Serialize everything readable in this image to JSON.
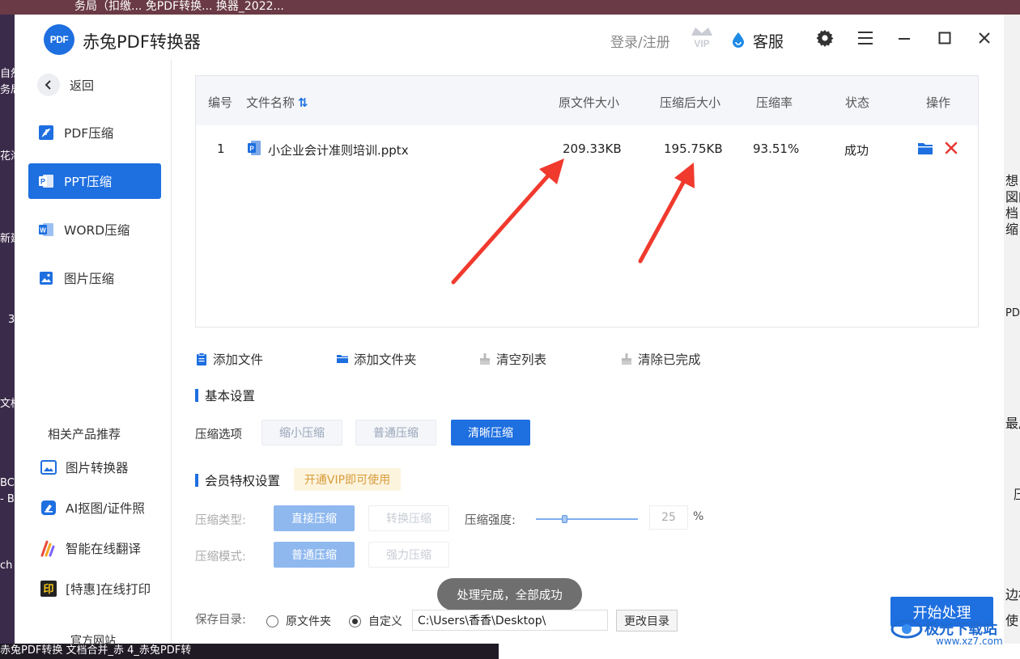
{
  "desktop": {
    "top_text": "务局（扣缴... 免PDF转换... 换器_2022...",
    "left_fragments": [
      "自然",
      "务局",
      "花海",
      "新建",
      "3",
      "文档",
      "BC",
      "- B",
      "ch"
    ],
    "right_fragments": [
      "想",
      "図的",
      "档",
      "缩",
      "PD",
      "最后",
      "压",
      "边框",
      "使"
    ],
    "taskbar_text": "赤兔PDF转换  文档合并_赤  4_赤兔PDF转",
    "watermark_text": "极光下载站",
    "watermark_url": "www.xz7.com"
  },
  "titlebar": {
    "logo_text": "PDF",
    "title": "赤兔PDF转换器",
    "login": "登录/注册",
    "vip_badge": "VIP",
    "service": "客服"
  },
  "sidebar": {
    "back": "返回",
    "nav": [
      {
        "label": "PDF压缩",
        "icon": "pdf-icon"
      },
      {
        "label": "PPT压缩",
        "icon": "ppt-icon",
        "active": true
      },
      {
        "label": "WORD压缩",
        "icon": "word-icon"
      },
      {
        "label": "图片压缩",
        "icon": "image-icon"
      }
    ],
    "recommend_title": "相关产品推荐",
    "recommend": [
      {
        "label": "图片转换器",
        "icon": "image-convert-icon"
      },
      {
        "label": "AI抠图/证件照",
        "icon": "eraser-icon"
      },
      {
        "label": "智能在线翻译",
        "icon": "translate-icon"
      },
      {
        "label": "[特惠]在线打印",
        "icon": "print-icon"
      }
    ],
    "official_site": "官方网站"
  },
  "table": {
    "headers": {
      "index": "编号",
      "name": "文件名称",
      "orig_size": "原文件大小",
      "new_size": "压缩后大小",
      "ratio": "压缩率",
      "status": "状态",
      "action": "操作"
    },
    "rows": [
      {
        "index": "1",
        "name": "小企业会计准则培训.pptx",
        "orig_size": "209.33KB",
        "new_size": "195.75KB",
        "ratio": "93.51%",
        "status": "成功"
      }
    ]
  },
  "toolbar": {
    "add_file": "添加文件",
    "add_folder": "添加文件夹",
    "clear_list": "清空列表",
    "clear_done": "清除已完成"
  },
  "basic": {
    "title": "基本设置",
    "option_label": "压缩选项",
    "options": [
      "缩小压缩",
      "普通压缩",
      "清晰压缩"
    ],
    "selected": "清晰压缩"
  },
  "vip": {
    "title": "会员特权设置",
    "tip": "开通VIP即可使用",
    "type_label": "压缩类型:",
    "types": [
      "直接压缩",
      "转换压缩"
    ],
    "strength_label": "压缩强度:",
    "strength_value": "25",
    "strength_unit": "%",
    "strength_fraction": 0.25,
    "mode_label": "压缩模式:",
    "modes": [
      "普通压缩",
      "强力压缩"
    ]
  },
  "toast": "处理完成，全部成功",
  "save": {
    "label": "保存目录:",
    "option_original": "原文件夹",
    "option_custom": "自定义",
    "selected": "自定义",
    "path": "C:\\Users\\香香\\Desktop\\",
    "change_button": "更改目录"
  },
  "start_button": "开始处理",
  "colors": {
    "accent": "#1e6fe0",
    "annotation_arrow": "#f03a2e",
    "delete_red": "#e53935",
    "vip_tip_bg": "#fdf4de"
  }
}
